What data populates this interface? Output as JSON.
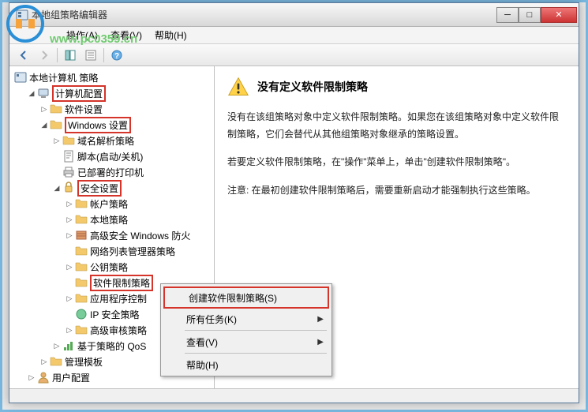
{
  "window": {
    "title": "本地组策略编辑器"
  },
  "watermark": "www.pc0359.cn",
  "menubar": {
    "items": [
      "操作(A)",
      "查看(V)",
      "帮助(H)"
    ]
  },
  "tree": {
    "root": "本地计算机 策略",
    "n1": "计算机配置",
    "n1_1": "软件设置",
    "n1_2": "Windows 设置",
    "n1_2_1": "域名解析策略",
    "n1_2_2": "脚本(启动/关机)",
    "n1_2_3": "已部署的打印机",
    "n1_2_4": "安全设置",
    "n1_2_4_1": "帐户策略",
    "n1_2_4_2": "本地策略",
    "n1_2_4_3": "高级安全 Windows 防火",
    "n1_2_4_4": "网络列表管理器策略",
    "n1_2_4_5": "公钥策略",
    "n1_2_4_6": "软件限制策略",
    "n1_2_4_7": "应用程序控制",
    "n1_2_4_8": "IP 安全策略",
    "n1_2_4_9": "高级审核策略",
    "n1_2_5": "基于策略的 QoS",
    "n1_3": "管理模板",
    "n2": "用户配置"
  },
  "content": {
    "title": "没有定义软件限制策略",
    "p1": "没有在该组策略对象中定义软件限制策略。如果您在该组策略对象中定义软件限制策略，它们会替代从其他组策略对象继承的策略设置。",
    "p2": "若要定义软件限制策略，在\"操作\"菜单上，单击\"创建软件限制策略\"。",
    "p3": "注意: 在最初创建软件限制策略后，需要重新启动才能强制执行这些策略。"
  },
  "context_menu": {
    "item1": "创建软件限制策略(S)",
    "item2": "所有任务(K)",
    "item3": "查看(V)",
    "item4": "帮助(H)"
  }
}
